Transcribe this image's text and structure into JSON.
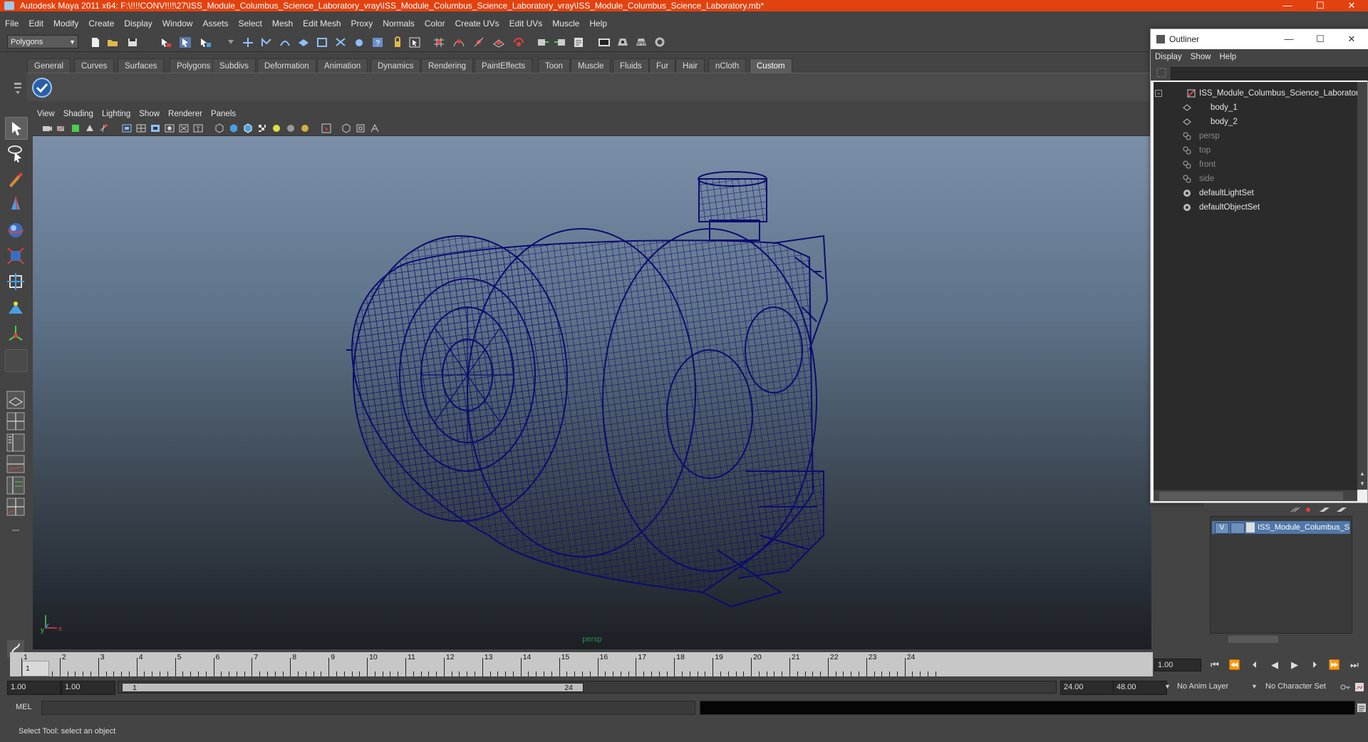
{
  "window": {
    "title": "Autodesk Maya 2011 x64: F:\\!!!!CONV!!!!\\27\\ISS_Module_Columbus_Science_Laboratory_vray\\ISS_Module_Columbus_Science_Laboratory_vray\\ISS_Module_Columbus_Science_Laboratory.mb*",
    "minimize": "—",
    "maximize": "☐",
    "close": "✕"
  },
  "menubar": [
    "File",
    "Edit",
    "Modify",
    "Create",
    "Display",
    "Window",
    "Assets",
    "Select",
    "Mesh",
    "Edit Mesh",
    "Proxy",
    "Normals",
    "Color",
    "Create UVs",
    "Edit UVs",
    "Muscle",
    "Help"
  ],
  "statusline": {
    "mode": "Polygons"
  },
  "shelf": {
    "tabs": [
      "General",
      "Curves",
      "Surfaces",
      "Polygons",
      "Subdivs",
      "Deformation",
      "Animation",
      "Dynamics",
      "Rendering",
      "PaintEffects",
      "Toon",
      "Muscle",
      "Fluids",
      "Fur",
      "Hair",
      "nCloth",
      "Custom"
    ],
    "active_tab": "Custom"
  },
  "panel": {
    "menu": [
      "View",
      "Shading",
      "Lighting",
      "Show",
      "Renderer",
      "Panels"
    ],
    "camera": "persp"
  },
  "timeslider": {
    "ticks": [
      "1",
      "2",
      "3",
      "4",
      "5",
      "6",
      "7",
      "8",
      "9",
      "10",
      "11",
      "12",
      "13",
      "14",
      "15",
      "16",
      "17",
      "18",
      "19",
      "20",
      "21",
      "22",
      "23",
      "24"
    ],
    "current_marker": "1",
    "current_frame": "1.00"
  },
  "range": {
    "start_time": "1.00",
    "playback_start": "1.00",
    "handle_start": "1",
    "handle_end": "24",
    "playback_end": "24.00",
    "end_time": "48.00",
    "anim_layer": "No Anim Layer",
    "character_set": "No Character Set"
  },
  "cmdline": {
    "label": "MEL"
  },
  "helpline": {
    "text": "Select Tool: select an object"
  },
  "outliner": {
    "title": "Outliner",
    "minimize": "—",
    "maximize": "☐",
    "close": "✕",
    "menu": [
      "Display",
      "Show",
      "Help"
    ],
    "items": [
      {
        "name": "ISS_Module_Columbus_Science_Laboratory",
        "dim": false
      },
      {
        "name": "body_1",
        "dim": false
      },
      {
        "name": "body_2",
        "dim": false
      },
      {
        "name": "persp",
        "dim": true
      },
      {
        "name": "top",
        "dim": true
      },
      {
        "name": "front",
        "dim": true
      },
      {
        "name": "side",
        "dim": true
      },
      {
        "name": "defaultLightSet",
        "dim": false
      },
      {
        "name": "defaultObjectSet",
        "dim": false
      }
    ]
  },
  "layers": {
    "rows": [
      {
        "visible": "V",
        "name": "ISS_Module_Columbus_S"
      }
    ]
  },
  "colors": {
    "titlebar": "#e2420f",
    "wireframe": "#0c0c6e",
    "layer_selected": "#5077a8"
  }
}
